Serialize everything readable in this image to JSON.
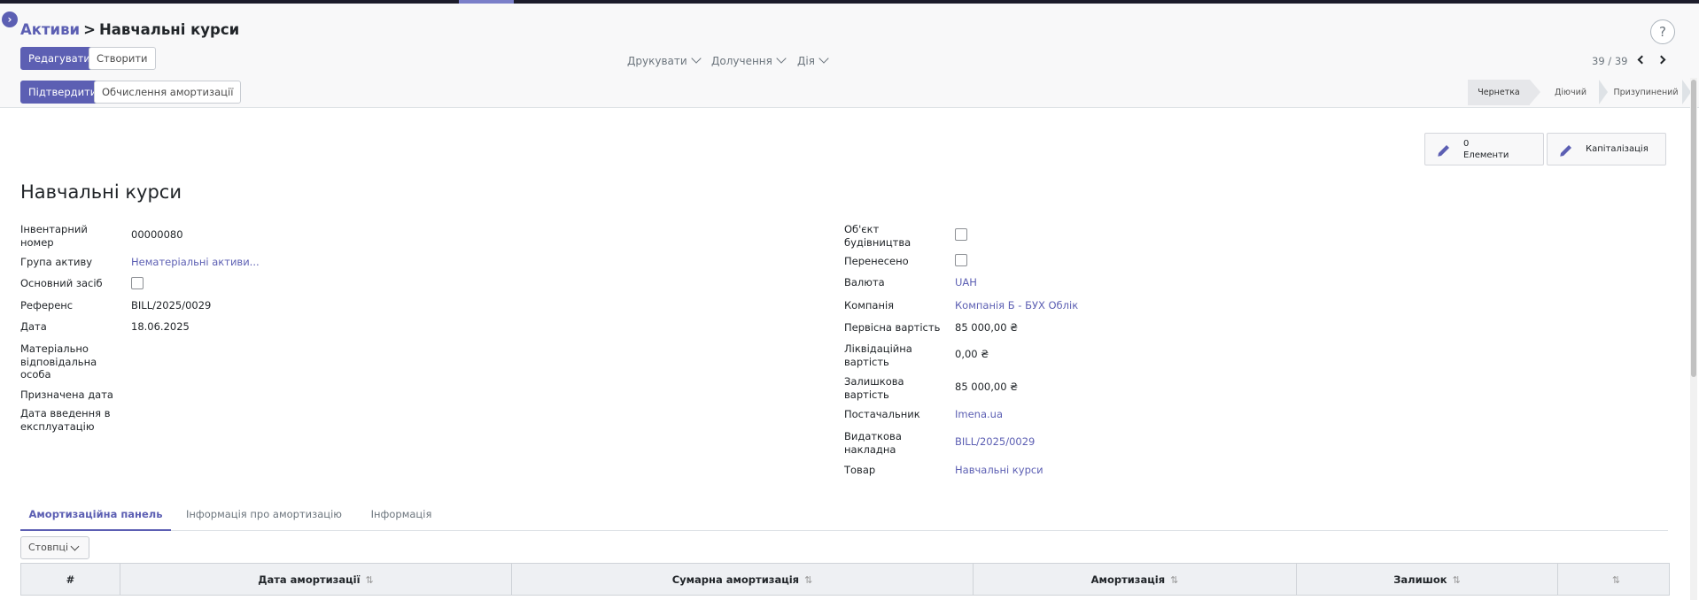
{
  "breadcrumb": {
    "parent": "Активи",
    "separator": ">",
    "current": "Навчальні курси"
  },
  "help": {
    "label": "?"
  },
  "toolbar": {
    "edit_label": "Редагувати",
    "create_label": "Створити"
  },
  "menus": {
    "print_label": "Друкувати",
    "attach_label": "Долучення",
    "action_label": "Дія"
  },
  "pager": {
    "value": "39 / 39"
  },
  "actions": {
    "confirm_label": "Підтвердити",
    "compute_label": "Обчислення амортизації"
  },
  "status": {
    "stages": [
      "Чернетка",
      "Діючий",
      "Призупинений"
    ],
    "active_stage": "Чернетка"
  },
  "smart_buttons": {
    "elements_count": "0",
    "elements_label": "Елементи",
    "capitalization_label": "Капіталізація"
  },
  "record": {
    "title": "Навчальні курси"
  },
  "left_fields": {
    "inventory_number": {
      "label_line1": "Інвентарний",
      "label_line2": "номер",
      "value": "00000080"
    },
    "asset_group": {
      "label": "Група активу",
      "value": "Нематеріальні активи..."
    },
    "fixed_asset": {
      "label": "Основний засіб",
      "checked": false
    },
    "reference": {
      "label": "Референс",
      "value": "BILL/2025/0029"
    },
    "date": {
      "label": "Дата",
      "value": "18.06.2025"
    },
    "responsible": {
      "label_line1": "Матеріально",
      "label_line2": "відповідальна",
      "label_line3": "особа"
    },
    "assigned_date": {
      "label": "Призначена дата"
    },
    "commission_date": {
      "label_line1": "Дата введення в",
      "label_line2": "експлуатацію"
    }
  },
  "right_fields": {
    "construction": {
      "label_line1": "Об'єкт",
      "label_line2": "будівництва",
      "checked": false
    },
    "transferred": {
      "label": "Перенесено",
      "checked": false
    },
    "currency": {
      "label": "Валюта",
      "value": "UAH"
    },
    "company": {
      "label": "Компанія",
      "value": "Компанія Б - БУХ Облік"
    },
    "original_value": {
      "label": "Первісна вартість",
      "value": "85 000,00 ₴"
    },
    "salvage_value": {
      "label_line1": "Ліквідаційна",
      "label_line2": "вартість",
      "value": "0,00 ₴"
    },
    "residual_value": {
      "label_line1": "Залишкова",
      "label_line2": "вартість",
      "value": "85 000,00 ₴"
    },
    "vendor": {
      "label": "Постачальник",
      "value": "Imena.ua"
    },
    "invoice": {
      "label_line1": "Видаткова",
      "label_line2": "накладна",
      "value": "BILL/2025/0029"
    },
    "product": {
      "label": "Товар",
      "value": "Навчальні курси"
    }
  },
  "tabs": [
    "Амортизаційна панель",
    "Інформація про амортизацію",
    "Інформація"
  ],
  "columns_button": {
    "label": "Стовпці"
  },
  "table": {
    "columns": [
      "#",
      "Дата амортизації",
      "Сумарна амортизація",
      "Амортизація",
      "Залишок",
      ""
    ],
    "rows": []
  },
  "colors": {
    "accent": "#5c5fb3",
    "header_bg": "#eef0f3"
  }
}
